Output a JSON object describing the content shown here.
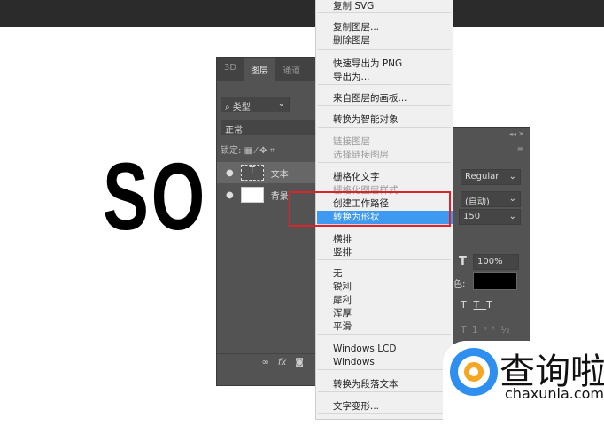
{
  "canvas_text": "SO",
  "layers_panel": {
    "tabs": [
      "3D",
      "图层",
      "通道"
    ],
    "filter": "类型",
    "blend_mode": "正常",
    "lock_label": "锁定:",
    "layers": [
      {
        "name": "文本",
        "thumb": "T"
      },
      {
        "name": "背景"
      }
    ],
    "bottom_icons": [
      "link-icon",
      "fx-icon",
      "mask-icon"
    ],
    "fx_label": "fx"
  },
  "context_menu": {
    "items": [
      {
        "label": "复制 SVG"
      },
      {
        "label": "复制图层..."
      },
      {
        "label": "删除图层"
      },
      {
        "label": "快速导出为 PNG"
      },
      {
        "label": "导出为..."
      },
      {
        "label": "来自图层的画板..."
      },
      {
        "label": "转换为智能对象"
      },
      {
        "label": "链接图层",
        "disabled": true
      },
      {
        "label": "选择链接图层",
        "disabled": true
      },
      {
        "label": "栅格化文字"
      },
      {
        "label": "栅格化图层样式",
        "disabled": true
      },
      {
        "label": "创建工作路径"
      },
      {
        "label": "转换为形状",
        "highlighted": true
      },
      {
        "label": "横排"
      },
      {
        "label": "竖排"
      },
      {
        "label": "无"
      },
      {
        "label": "锐利"
      },
      {
        "label": "犀利"
      },
      {
        "label": "浑厚"
      },
      {
        "label": "平滑"
      },
      {
        "label": "Windows LCD"
      },
      {
        "label": "Windows"
      },
      {
        "label": "转换为段落文本"
      },
      {
        "label": "文字变形..."
      }
    ]
  },
  "character_panel": {
    "font_style": "Regular",
    "leading": "(自动)",
    "tracking": "150",
    "scale": "100%",
    "color_label": "色:",
    "color": "#000000"
  },
  "watermark": {
    "cn": "查询啦",
    "en": "chaxunla.com"
  },
  "colors": {
    "highlight": "#3d9af0",
    "annotation": "#e0202a",
    "panel": "#535353"
  }
}
